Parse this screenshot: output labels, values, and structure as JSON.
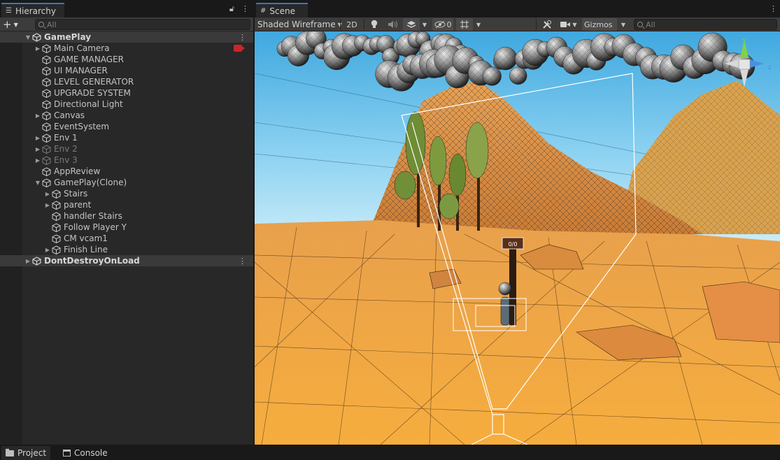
{
  "hierarchy": {
    "tab_label": "Hierarchy",
    "search_placeholder": "All",
    "add_icon": "plus-icon",
    "lock_icon": "lock-icon",
    "menu_icon": "kebab-menu-icon",
    "rows": [
      {
        "label": "GamePlay",
        "depth": 0,
        "kind": "scene",
        "arrow": "open"
      },
      {
        "label": "Main Camera",
        "depth": 1,
        "kind": "object",
        "arrow": "closed",
        "badge": "camera-icon"
      },
      {
        "label": "GAME MANAGER",
        "depth": 1,
        "kind": "object",
        "arrow": "none"
      },
      {
        "label": "UI MANAGER",
        "depth": 1,
        "kind": "object",
        "arrow": "none"
      },
      {
        "label": "LEVEL GENERATOR",
        "depth": 1,
        "kind": "object",
        "arrow": "none"
      },
      {
        "label": "UPGRADE SYSTEM",
        "depth": 1,
        "kind": "object",
        "arrow": "none"
      },
      {
        "label": "Directional Light",
        "depth": 1,
        "kind": "object",
        "arrow": "none"
      },
      {
        "label": "Canvas",
        "depth": 1,
        "kind": "object",
        "arrow": "closed"
      },
      {
        "label": "EventSystem",
        "depth": 1,
        "kind": "object",
        "arrow": "none"
      },
      {
        "label": "Env 1",
        "depth": 1,
        "kind": "object",
        "arrow": "closed"
      },
      {
        "label": "Env 2",
        "depth": 1,
        "kind": "object",
        "arrow": "closed",
        "dim": true
      },
      {
        "label": "Env 3",
        "depth": 1,
        "kind": "object",
        "arrow": "closed",
        "dim": true
      },
      {
        "label": "AppReview",
        "depth": 1,
        "kind": "object",
        "arrow": "none"
      },
      {
        "label": "GamePlay(Clone)",
        "depth": 1,
        "kind": "object",
        "arrow": "open"
      },
      {
        "label": "Stairs",
        "depth": 2,
        "kind": "object",
        "arrow": "closed"
      },
      {
        "label": "parent",
        "depth": 2,
        "kind": "object",
        "arrow": "closed"
      },
      {
        "label": "handler Stairs",
        "depth": 2,
        "kind": "object",
        "arrow": "none"
      },
      {
        "label": "Follow Player Y",
        "depth": 2,
        "kind": "object",
        "arrow": "none"
      },
      {
        "label": "CM vcam1",
        "depth": 2,
        "kind": "object",
        "arrow": "none"
      },
      {
        "label": "Finish Line",
        "depth": 2,
        "kind": "object",
        "arrow": "closed"
      },
      {
        "label": "DontDestroyOnLoad",
        "depth": 0,
        "kind": "scene",
        "arrow": "closed"
      }
    ]
  },
  "scene": {
    "tab_label": "Scene",
    "shading_mode": "Shaded Wireframe",
    "mode_2d": "2D",
    "hidden_count": "0",
    "gizmos_label": "Gizmos",
    "search_placeholder": "All",
    "toolbar_icons": [
      "lightbulb-icon",
      "audio-icon",
      "effects-icon",
      "hidden-objects-icon",
      "grid-icon",
      "tools-icon",
      "camera-icon"
    ],
    "gizmo_axes": {
      "y": "y",
      "z": "z"
    },
    "sign_text": "0/0"
  },
  "bottom_tabs": [
    {
      "label": "Project",
      "icon": "folder-icon"
    },
    {
      "label": "Console",
      "icon": "console-icon"
    }
  ],
  "colors": {
    "accent_tab": "#3a79bb",
    "panel_bg": "#282828",
    "sky_top": "#4fb6e6",
    "ground": "#f0a742",
    "mountain": "#d98a3a"
  }
}
